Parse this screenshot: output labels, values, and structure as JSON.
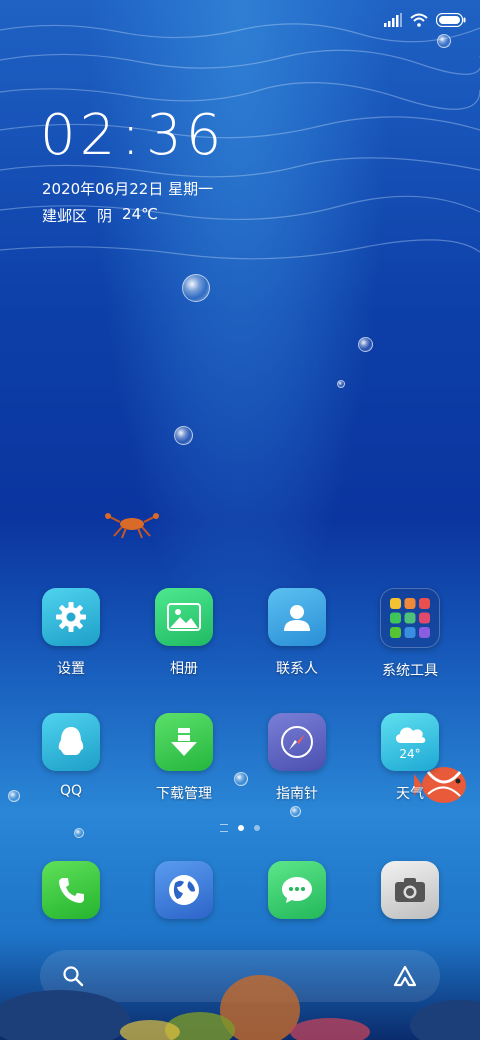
{
  "status": {
    "signal_icon": "signal-icon",
    "wifi_icon": "wifi-icon",
    "battery_icon": "battery-icon"
  },
  "clock": {
    "hours": "02",
    "minutes": "36"
  },
  "date": "2020年06月22日 星期一",
  "weather": {
    "location": "建邺区",
    "condition": "阴",
    "temperature": "24℃"
  },
  "apps_row1": [
    {
      "label": "设置",
      "icon": "gear-icon",
      "color": "#2fb6d8"
    },
    {
      "label": "相册",
      "icon": "photo-icon",
      "color": "#2fd27a"
    },
    {
      "label": "联系人",
      "icon": "contact-icon",
      "color": "#35a7e0"
    },
    {
      "label": "系统工具",
      "icon": "folder-icon",
      "color": "#1d4a9a"
    }
  ],
  "apps_row2": [
    {
      "label": "QQ",
      "icon": "qq-icon",
      "color": "#2fb6d8"
    },
    {
      "label": "下载管理",
      "icon": "download-icon",
      "color": "#35c95a"
    },
    {
      "label": "指南针",
      "icon": "compass-icon",
      "color": "#5b63c0"
    },
    {
      "label": "天气",
      "icon": "weather-icon",
      "color": "#2ec0e0",
      "badge": "24°"
    }
  ],
  "dock": [
    {
      "icon": "phone-icon",
      "color": "#36c94a"
    },
    {
      "icon": "browser-icon",
      "color": "#3d7fdc"
    },
    {
      "icon": "message-icon",
      "color": "#34c95a"
    },
    {
      "icon": "camera-icon",
      "color": "#cfcfcf"
    }
  ],
  "search": {
    "search_icon": "search-icon",
    "assistant_icon": "assistant-icon"
  }
}
